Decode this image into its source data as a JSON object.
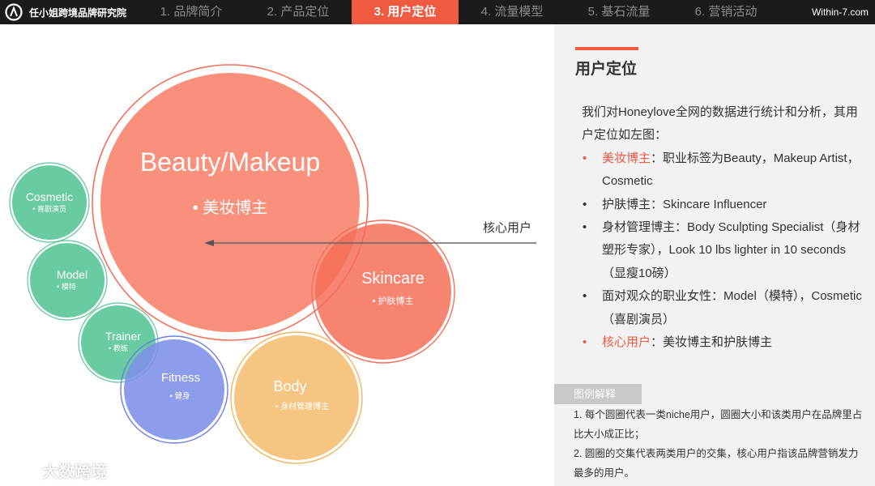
{
  "header": {
    "brand_name": "任小姐跨境品牌研究院",
    "tabs": [
      "1. 品牌简介",
      "2. 产品定位",
      "3. 用户定位",
      "4. 流量模型",
      "5. 基石流量",
      "6. 营销活动"
    ],
    "active_tab_index": 2,
    "site": "Within-7.com"
  },
  "diagram": {
    "bubbles": {
      "beauty": {
        "title": "Beauty/Makeup",
        "subtitle": "• 美妆博主",
        "color": "#f98a75"
      },
      "skincare": {
        "title": "Skincare",
        "subtitle": "• 护肤博主",
        "color": "#f46f58"
      },
      "cosmetic": {
        "title": "Cosmetic",
        "subtitle": "• 喜剧演员",
        "color": "#5cc79a"
      },
      "model": {
        "title": "Model",
        "subtitle": "• 模特",
        "color": "#5cc79a"
      },
      "trainer": {
        "title": "Trainer",
        "subtitle": "• 教练",
        "color": "#5cc79a"
      },
      "fitness": {
        "title": "Fitness",
        "subtitle": "• 健身",
        "color": "#7e8fe8"
      },
      "body": {
        "title": "Body",
        "subtitle": "• 身材管理博主",
        "color": "#f5c077"
      }
    },
    "arrow_label": "核心用户"
  },
  "panel": {
    "title": "用户定位",
    "intro": "我们对Honeylove全网的数据进行统计和分析，其用户定位如左图：",
    "bullets": [
      {
        "highlight": "美妆博主",
        "text": "：职业标签为Beauty，Makeup Artist，Cosmetic",
        "accent": true
      },
      {
        "highlight": "",
        "text": "护肤博主：Skincare Influencer",
        "accent": false
      },
      {
        "highlight": "",
        "text": "身材管理博主：Body Sculpting Specialist（身材塑形专家），Look 10 lbs lighter in 10 seconds（显瘦10磅）",
        "accent": false
      },
      {
        "highlight": "",
        "text": "面对观众的职业女性：Model（模特），Cosmetic（喜剧演员）",
        "accent": false
      },
      {
        "highlight": "核心用户",
        "text": "：美妆博主和护肤博主",
        "accent": true
      }
    ],
    "legend_tag": "图例解释",
    "legend_lines": [
      "1. 每个圆圈代表一类niche用户，圆圈大小和该类用户在品牌里占比大小成正比；",
      "2. 圆圈的交集代表两类用户的交集，核心用户指该品牌营销发力最多的用户。"
    ]
  },
  "watermark": "大数跨境",
  "colors": {
    "accent": "#ef5a40",
    "topbar": "#1b1b1b",
    "panel": "#f2f2f2"
  }
}
